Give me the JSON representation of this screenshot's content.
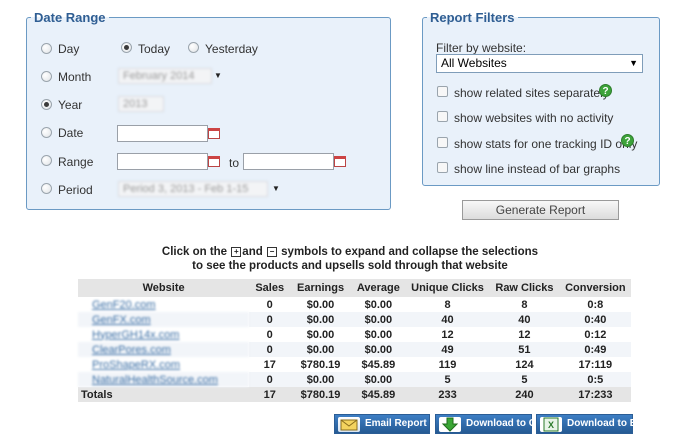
{
  "date_range": {
    "legend": "Date Range",
    "day": {
      "label": "Day",
      "checked": false
    },
    "today": {
      "label": "Today",
      "checked": true
    },
    "yesterday": {
      "label": "Yesterday",
      "checked": false
    },
    "month": {
      "label": "Month",
      "checked": false,
      "value": "February 2014"
    },
    "year": {
      "label": "Year",
      "checked": true,
      "value": "2013"
    },
    "date": {
      "label": "Date",
      "checked": false
    },
    "range": {
      "label": "Range",
      "checked": false,
      "to": "to"
    },
    "period": {
      "label": "Period",
      "checked": false,
      "value": "Period 3, 2013 - Feb 1-15"
    }
  },
  "report_filters": {
    "legend": "Report Filters",
    "filter_by_label": "Filter by website:",
    "website_select": "All Websites",
    "options": [
      {
        "label": "show related sites separately",
        "checked": false,
        "help": true
      },
      {
        "label": "show websites with no activity",
        "checked": false,
        "help": false
      },
      {
        "label": "show stats for one tracking ID only",
        "checked": false,
        "help": true
      },
      {
        "label": "show line instead of bar graphs",
        "checked": false,
        "help": false
      }
    ],
    "generate_button": "Generate Report",
    "help_icon": "?"
  },
  "info": {
    "line1_a": "Click on the",
    "line1_plus": "+",
    "line1_and": "and",
    "line1_minus": "−",
    "line1_b": "symbols to expand and collapse the selections",
    "line2": "to see the products and upsells sold through that website"
  },
  "table": {
    "headers": [
      "Website",
      "Sales",
      "Earnings",
      "Average",
      "Unique Clicks",
      "Raw Clicks",
      "Conversion"
    ],
    "rows": [
      [
        "GenF20.com",
        "0",
        "$0.00",
        "$0.00",
        "8",
        "8",
        "0:8"
      ],
      [
        "GenFX.com",
        "0",
        "$0.00",
        "$0.00",
        "40",
        "40",
        "0:40"
      ],
      [
        "HyperGH14x.com",
        "0",
        "$0.00",
        "$0.00",
        "12",
        "12",
        "0:12"
      ],
      [
        "ClearPores.com",
        "0",
        "$0.00",
        "$0.00",
        "49",
        "51",
        "0:49"
      ],
      [
        "ProShapeRX.com",
        "17",
        "$780.19",
        "$45.89",
        "119",
        "124",
        "17:119"
      ],
      [
        "NaturalHealthSource.com",
        "0",
        "$0.00",
        "$0.00",
        "5",
        "5",
        "0:5"
      ]
    ],
    "totals": [
      "Totals",
      "17",
      "$780.19",
      "$45.89",
      "233",
      "240",
      "17:233"
    ]
  },
  "export": {
    "email": "Email Report",
    "csv": "Download to CSV",
    "excel": "Download to Excel"
  }
}
